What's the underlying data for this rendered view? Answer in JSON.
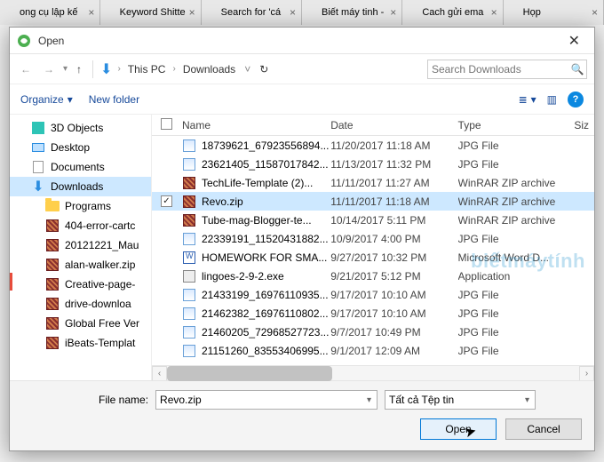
{
  "browserTabs": [
    {
      "label": "ong cụ lập kế"
    },
    {
      "label": "Keyword Shitte"
    },
    {
      "label": "Search for 'cá"
    },
    {
      "label": "Biết máy tinh -"
    },
    {
      "label": "Cach gửi ema"
    },
    {
      "label": "Họp"
    }
  ],
  "dialog": {
    "title": "Open"
  },
  "path": {
    "seg1": "This PC",
    "seg2": "Downloads"
  },
  "search": {
    "placeholder": "Search Downloads"
  },
  "toolbar": {
    "organize": "Organize",
    "newFolder": "New folder"
  },
  "columns": {
    "name": "Name",
    "date": "Date",
    "type": "Type",
    "size": "Siz"
  },
  "sidebar": [
    {
      "label": "3D Objects",
      "icon": "3d"
    },
    {
      "label": "Desktop",
      "icon": "desktop"
    },
    {
      "label": "Documents",
      "icon": "docs"
    },
    {
      "label": "Downloads",
      "icon": "down",
      "selected": true
    },
    {
      "label": "Programs",
      "icon": "folder",
      "indent": true
    },
    {
      "label": "404-error-cartc",
      "icon": "zip",
      "indent": true
    },
    {
      "label": "20121221_Mau",
      "icon": "zip",
      "indent": true
    },
    {
      "label": "alan-walker.zip",
      "icon": "zip",
      "indent": true
    },
    {
      "label": "Creative-page-",
      "icon": "zip",
      "indent": true
    },
    {
      "label": "drive-downloa",
      "icon": "zip",
      "indent": true
    },
    {
      "label": "Global Free Ver",
      "icon": "zip",
      "indent": true
    },
    {
      "label": "iBeats-Templat",
      "icon": "zip",
      "indent": true
    }
  ],
  "files": [
    {
      "name": "18739621_67923556894...",
      "date": "11/20/2017 11:18 AM",
      "type": "JPG File",
      "icon": "jpg"
    },
    {
      "name": "23621405_11587017842...",
      "date": "11/13/2017 11:32 PM",
      "type": "JPG File",
      "icon": "jpg"
    },
    {
      "name": "TechLife-Template (2)...",
      "date": "11/11/2017 11:27 AM",
      "type": "WinRAR ZIP archive",
      "icon": "zip"
    },
    {
      "name": "Revo.zip",
      "date": "11/11/2017 11:18 AM",
      "type": "WinRAR ZIP archive",
      "icon": "zip",
      "selected": true,
      "checked": true
    },
    {
      "name": "Tube-mag-Blogger-te...",
      "date": "10/14/2017 5:11 PM",
      "type": "WinRAR ZIP archive",
      "icon": "zip"
    },
    {
      "name": "22339191_11520431882...",
      "date": "10/9/2017 4:00 PM",
      "type": "JPG File",
      "icon": "jpg"
    },
    {
      "name": "HOMEWORK FOR SMA...",
      "date": "9/27/2017 10:32 PM",
      "type": "Microsoft Word D...",
      "icon": "doc"
    },
    {
      "name": "lingoes-2-9-2.exe",
      "date": "9/21/2017 5:12 PM",
      "type": "Application",
      "icon": "exe"
    },
    {
      "name": "21433199_16976110935...",
      "date": "9/17/2017 10:10 AM",
      "type": "JPG File",
      "icon": "jpg"
    },
    {
      "name": "21462382_16976110802...",
      "date": "9/17/2017 10:10 AM",
      "type": "JPG File",
      "icon": "jpg"
    },
    {
      "name": "21460205_72968527723...",
      "date": "9/7/2017 10:49 PM",
      "type": "JPG File",
      "icon": "jpg"
    },
    {
      "name": "21151260_83553406995...",
      "date": "9/1/2017 12:09 AM",
      "type": "JPG File",
      "icon": "jpg"
    }
  ],
  "footer": {
    "fileNameLabel": "File name:",
    "fileNameValue": "Revo.zip",
    "filterValue": "Tất cả Tệp tin",
    "open": "Open",
    "cancel": "Cancel"
  },
  "watermark": "biếtmáytính"
}
